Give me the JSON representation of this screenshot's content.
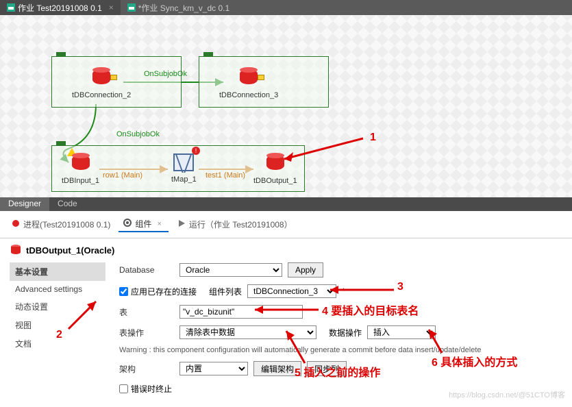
{
  "tabs": [
    {
      "label": "作业 Test20191008 0.1",
      "active": true
    },
    {
      "label": "*作业 Sync_km_v_dc 0.1",
      "active": false
    }
  ],
  "canvas": {
    "nodes": {
      "conn2": "tDBConnection_2",
      "conn3": "tDBConnection_3",
      "input1": "tDBInput_1",
      "tmap": "tMap_1",
      "output1": "tDBOutput_1"
    },
    "edges": {
      "subjob1": "OnSubjobOk",
      "subjob2": "OnSubjobOk",
      "row1": "row1 (Main)",
      "test1": "test1 (Main)"
    }
  },
  "design_tabs": {
    "designer": "Designer",
    "code": "Code"
  },
  "views": {
    "process": "进程(Test20191008 0.1)",
    "component": "组件",
    "run": "运行（作业 Test20191008）"
  },
  "panel": {
    "title": "tDBOutput_1(Oracle)",
    "side": {
      "basic": "基本设置",
      "advanced": "Advanced settings",
      "dynamic": "动态设置",
      "view": "视图",
      "doc": "文档"
    },
    "form": {
      "database_label": "Database",
      "database_value": "Oracle",
      "apply": "Apply",
      "use_existing": "应用已存在的连接",
      "conn_list_label": "组件列表",
      "conn_list_value": "tDBConnection_3",
      "table_label": "表",
      "table_value": "\"v_dc_bizunit\"",
      "table_op_label": "表操作",
      "table_op_value": "清除表中数据",
      "data_op_label": "数据操作",
      "data_op_value": "插入",
      "warning": "Warning : this component configuration will automatically generate a commit before data insert/update/delete",
      "schema_label": "架构",
      "schema_value": "内置",
      "edit_schema": "编辑架构",
      "same_col": "同步列",
      "die_on_error": "错误时终止"
    }
  },
  "annotations": {
    "a1": "1",
    "a2": "2",
    "a3": "3",
    "a4": "4  要插入的目标表名",
    "a5": "5 插入之前的操作",
    "a6": "6 具体插入的方式"
  },
  "watermark": "https://blog.csdn.net/@51CTO博客"
}
